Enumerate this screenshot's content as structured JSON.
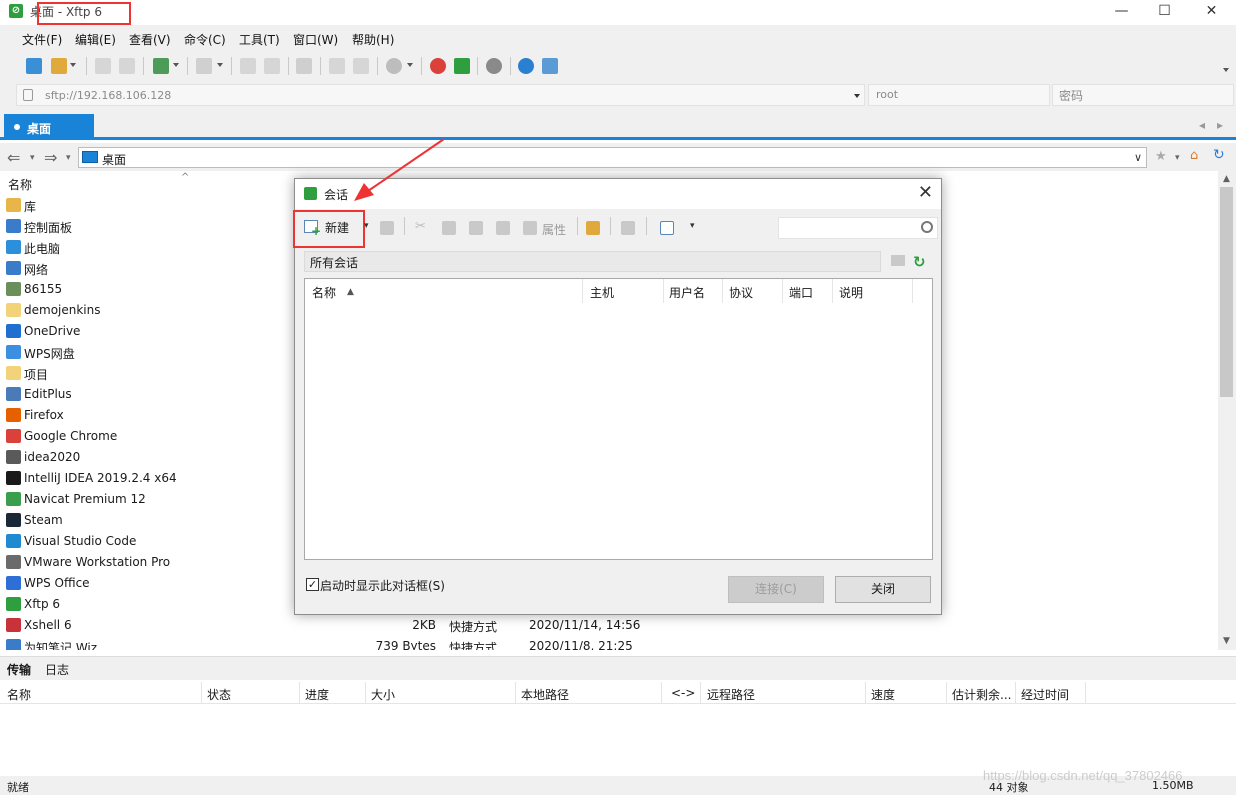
{
  "window": {
    "title": "桌面 - Xftp 6",
    "controls": {
      "minimize": "—",
      "maximize": "☐",
      "close": "✕"
    }
  },
  "menu": [
    "文件(F)",
    "编辑(E)",
    "查看(V)",
    "命令(C)",
    "工具(T)",
    "窗口(W)",
    "帮助(H)"
  ],
  "address": {
    "url_placeholder": "sftp://192.168.106.128",
    "user_placeholder": "root",
    "password_placeholder": "密码"
  },
  "tab": {
    "label": "桌面"
  },
  "path": {
    "label": "桌面"
  },
  "file_list": {
    "header_name": "名称",
    "sort_indicator": "^",
    "items": [
      {
        "name": "库",
        "icon": "library-icon",
        "color": "#e8b54b"
      },
      {
        "name": "控制面板",
        "icon": "control-panel-icon",
        "color": "#3a7cc9"
      },
      {
        "name": "此电脑",
        "icon": "computer-icon",
        "color": "#2b8fdb"
      },
      {
        "name": "网络",
        "icon": "network-icon",
        "color": "#3a7cc9"
      },
      {
        "name": "86155",
        "icon": "user-icon",
        "color": "#6b8e5a"
      },
      {
        "name": "demojenkins",
        "icon": "folder-icon",
        "color": "#f3d37a"
      },
      {
        "name": "OneDrive",
        "icon": "cloud-icon",
        "color": "#1f6fd1"
      },
      {
        "name": "WPS网盘",
        "icon": "wps-cloud-icon",
        "color": "#3b8ee0"
      },
      {
        "name": "项目",
        "icon": "folder-icon",
        "color": "#f3d37a"
      },
      {
        "name": "EditPlus",
        "icon": "editplus-icon",
        "color": "#4a7ab8"
      },
      {
        "name": "Firefox",
        "icon": "firefox-icon",
        "color": "#e66000"
      },
      {
        "name": "Google Chrome",
        "icon": "chrome-icon",
        "color": "#d9413a"
      },
      {
        "name": "idea2020",
        "icon": "shortcut-icon",
        "color": "#5a5a5a"
      },
      {
        "name": "IntelliJ IDEA 2019.2.4 x64",
        "icon": "intellij-icon",
        "color": "#1a1a1a"
      },
      {
        "name": "Navicat Premium 12",
        "icon": "navicat-icon",
        "color": "#3a9f4c"
      },
      {
        "name": "Steam",
        "icon": "steam-icon",
        "color": "#1b2838"
      },
      {
        "name": "Visual Studio Code",
        "icon": "vscode-icon",
        "color": "#1f8ad2"
      },
      {
        "name": "VMware Workstation Pro",
        "icon": "vmware-icon",
        "color": "#6b6b6b"
      },
      {
        "name": "WPS Office",
        "icon": "wps-icon",
        "color": "#2d6fd6"
      },
      {
        "name": "Xftp 6",
        "icon": "xftp-icon",
        "color": "#2f9e3f"
      },
      {
        "name": "Xshell 6",
        "icon": "xshell-icon",
        "color": "#c8323a",
        "size": "2KB",
        "type": "快捷方式",
        "date": "2020/11/14, 14:56"
      },
      {
        "name": "为知笔记 Wiz",
        "icon": "wiz-icon",
        "color": "#3a7cc9",
        "size": "739 Bytes",
        "type": "快捷方式",
        "date": "2020/11/8, 21:25"
      }
    ]
  },
  "bottom_tabs": [
    "传输",
    "日志"
  ],
  "transfer_columns": [
    "名称",
    "状态",
    "进度",
    "大小",
    "本地路径",
    "<->",
    "远程路径",
    "速度",
    "估计剩余...",
    "经过时间"
  ],
  "status": {
    "left": "就绪",
    "count": "44 对象",
    "size": "1.50MB"
  },
  "watermark": "https://blog.csdn.net/qq_37802466",
  "dialog": {
    "title": "会话",
    "close": "✕",
    "new_label": "新建",
    "properties_label": "属性",
    "search_placeholder": "",
    "folder_label": "所有会话",
    "columns": [
      "名称",
      "主机",
      "用户名",
      "协议",
      "端口",
      "说明"
    ],
    "sort_indicator": "▲",
    "startup_checkbox_label": "启动时显示此对话框(S)",
    "startup_checked": true,
    "connect_label": "连接(C)",
    "close_label": "关闭"
  },
  "colors": {
    "accent": "#1883d7",
    "highlight": "#e33333",
    "app_green": "#2f9e3f"
  }
}
